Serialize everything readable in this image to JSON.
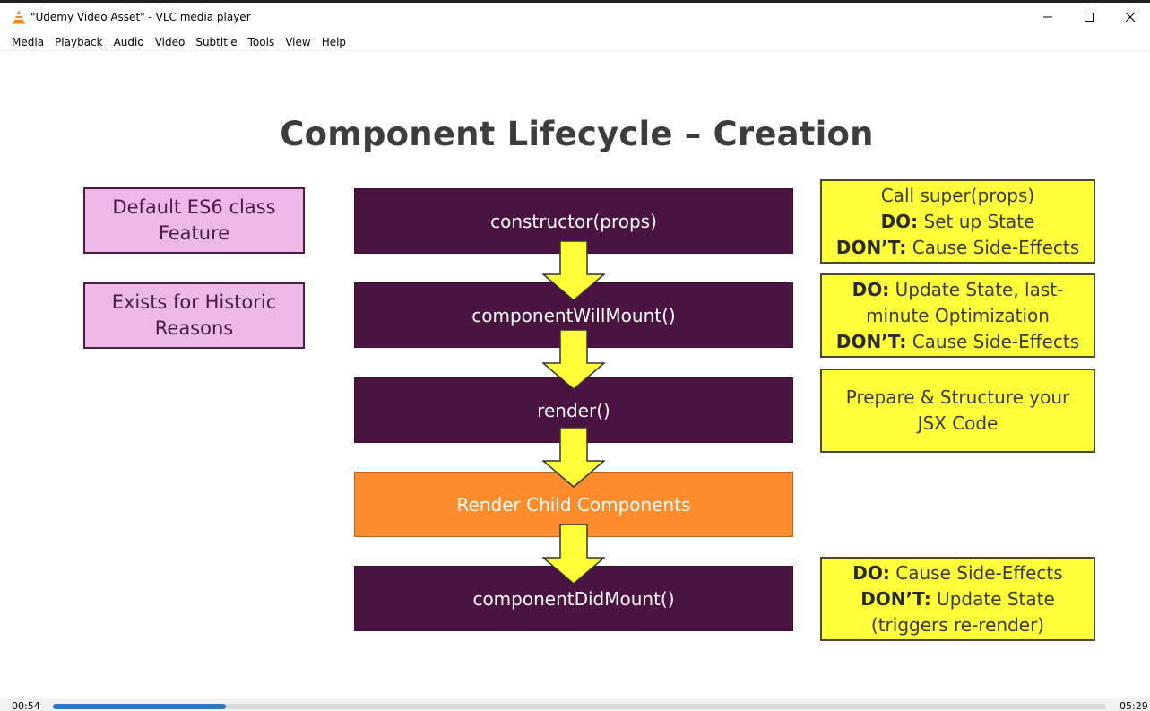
{
  "window": {
    "title": "\"Udemy Video Asset\" - VLC media player",
    "app_icon": "vlc-cone-icon",
    "controls": [
      "minimize-icon",
      "maximize-icon",
      "close-icon"
    ]
  },
  "menu": {
    "items": [
      "Media",
      "Playback",
      "Audio",
      "Video",
      "Subtitle",
      "Tools",
      "View",
      "Help"
    ]
  },
  "slide": {
    "title": "Component Lifecycle – Creation",
    "side_notes": [
      {
        "line1": "Default ES6 class",
        "line2": "Feature"
      },
      {
        "line1": "Exists for Historic",
        "line2": "Reasons"
      }
    ],
    "steps": [
      {
        "label": "constructor(props)"
      },
      {
        "label": "componentWillMount()"
      },
      {
        "label": "render()"
      },
      {
        "label": "Render Child Components"
      },
      {
        "label": "componentDidMount()"
      }
    ],
    "notes": [
      {
        "l1": "Call super(props)",
        "l2_bold": "DO:",
        "l2": " Set up State",
        "l3_bold": "DON’T:",
        "l3": " Cause Side-Effects"
      },
      {
        "l1_bold": "DO:",
        "l1": " Update State, last-",
        "l2": "minute Optimization",
        "l3_bold": "DON’T:",
        "l3": " Cause Side-Effects"
      },
      {
        "l1": "Prepare & Structure your",
        "l2": "JSX Code"
      },
      {
        "l1_bold": "DO:",
        "l1": " Cause Side-Effects",
        "l2_bold": "DON’T:",
        "l2": " Update State",
        "l3": "(triggers re-render)"
      }
    ],
    "colors": {
      "step": "#4a1342",
      "child_step": "#fd8c2d",
      "note": "#ffff3a",
      "side_note": "#ebb8e8",
      "arrow": "#ffff3a"
    }
  },
  "player": {
    "elapsed": "00:54",
    "total": "05:29",
    "progress": 0.164
  }
}
